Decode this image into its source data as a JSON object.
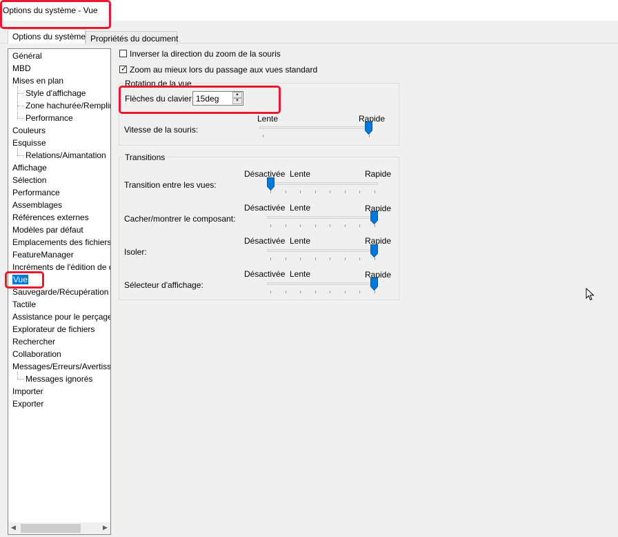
{
  "window": {
    "title": "Options du système - Vue"
  },
  "tabs": [
    {
      "label": "Options du système",
      "active": true
    },
    {
      "label": "Propriétés du document",
      "active": false
    }
  ],
  "tree": {
    "items": [
      {
        "label": "Général",
        "level": 0
      },
      {
        "label": "MBD",
        "level": 0
      },
      {
        "label": "Mises en plan",
        "level": 0
      },
      {
        "label": "Style d'affichage",
        "level": 1
      },
      {
        "label": "Zone hachurée/Remplir",
        "level": 1
      },
      {
        "label": "Performance",
        "level": 1
      },
      {
        "label": "Couleurs",
        "level": 0
      },
      {
        "label": "Esquisse",
        "level": 0
      },
      {
        "label": "Relations/Aimantation",
        "level": 1
      },
      {
        "label": "Affichage",
        "level": 0
      },
      {
        "label": "Sélection",
        "level": 0
      },
      {
        "label": "Performance",
        "level": 0
      },
      {
        "label": "Assemblages",
        "level": 0
      },
      {
        "label": "Références externes",
        "level": 0
      },
      {
        "label": "Modèles par défaut",
        "level": 0
      },
      {
        "label": "Emplacements des fichiers",
        "level": 0
      },
      {
        "label": "FeatureManager",
        "level": 0
      },
      {
        "label": "Incréments de l'édition de c",
        "level": 0
      },
      {
        "label": "Vue",
        "level": 0,
        "selected": true
      },
      {
        "label": "Sauvegarde/Récupération",
        "level": 0
      },
      {
        "label": "Tactile",
        "level": 0
      },
      {
        "label": "Assistance pour le perçage/",
        "level": 0
      },
      {
        "label": "Explorateur de fichiers",
        "level": 0
      },
      {
        "label": "Rechercher",
        "level": 0
      },
      {
        "label": "Collaboration",
        "level": 0
      },
      {
        "label": "Messages/Erreurs/Avertisse",
        "level": 0
      },
      {
        "label": "Messages ignorés",
        "level": 1
      },
      {
        "label": "Importer",
        "level": 0
      },
      {
        "label": "Exporter",
        "level": 0
      }
    ]
  },
  "options": {
    "invert_zoom": {
      "label": "Inverser la direction du zoom de la souris",
      "checked": false
    },
    "zoom_fit": {
      "label": "Zoom au mieux lors du passage aux vues standard",
      "checked": true
    }
  },
  "rotation": {
    "group_title": "Rotation de la vue",
    "arrow_keys_label": "Flèches du clavier:",
    "arrow_keys_value": "15deg",
    "mouse_speed_label": "Vitesse de la souris:",
    "slow_label": "Lente",
    "fast_label": "Rapide",
    "mouse_speed_level": 1.0
  },
  "transitions": {
    "group_title": "Transitions",
    "off_label": "Désactivée",
    "slow_label": "Lente",
    "fast_label": "Rapide",
    "rows": [
      {
        "label": "Transition entre les vues:",
        "level": 0.0
      },
      {
        "label": "Cacher/montrer le composant:",
        "level": 1.0
      },
      {
        "label": "Isoler:",
        "level": 1.0
      },
      {
        "label": "Sélecteur d'affichage:",
        "level": 1.0
      }
    ]
  },
  "colors": {
    "accent": "#0078d7",
    "highlight": "#e8192c"
  }
}
